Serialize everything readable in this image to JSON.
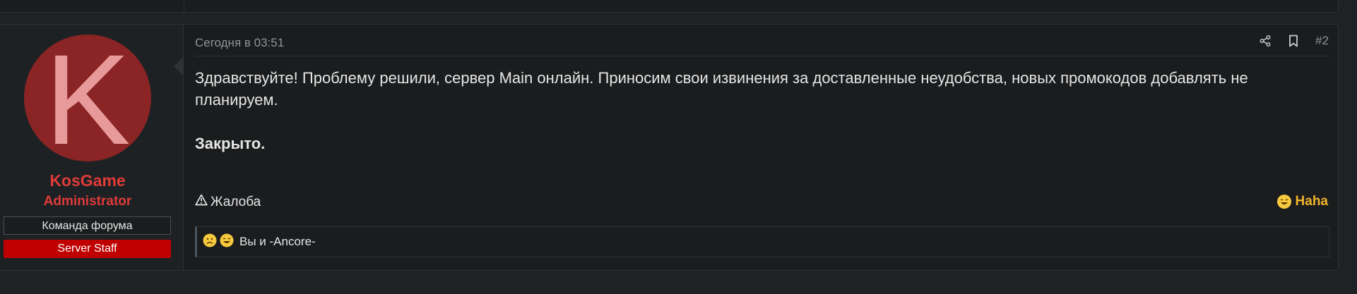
{
  "post": {
    "date": "Сегодня в 03:51",
    "number": "#2",
    "message": "Здравствуйте! Проблему решили, сервер Main онлайн. Приносим свои извинения за доставленные неудобства, новых промокодов добавлять не планируем.",
    "closed": "Закрыто.",
    "report_label": "Жалоба",
    "reaction_label": "Haha",
    "reactions_summary": "Вы и -Ancore-"
  },
  "user": {
    "avatar_letter": "K",
    "name": "KosGame",
    "role": "Administrator",
    "banners": [
      "Команда форума",
      "Server Staff"
    ]
  },
  "icons": {
    "share": "share-icon",
    "bookmark": "bookmark-icon",
    "report": "warning-icon",
    "reaction": "laughing-emoji-icon",
    "reactions_list": [
      "sad-emoji-icon",
      "laughing-emoji-icon"
    ]
  },
  "colors": {
    "username": "#e03a3a",
    "staff_banner": "#c00000",
    "avatar_bg": "#8b2424",
    "reaction": "#f0b429"
  }
}
